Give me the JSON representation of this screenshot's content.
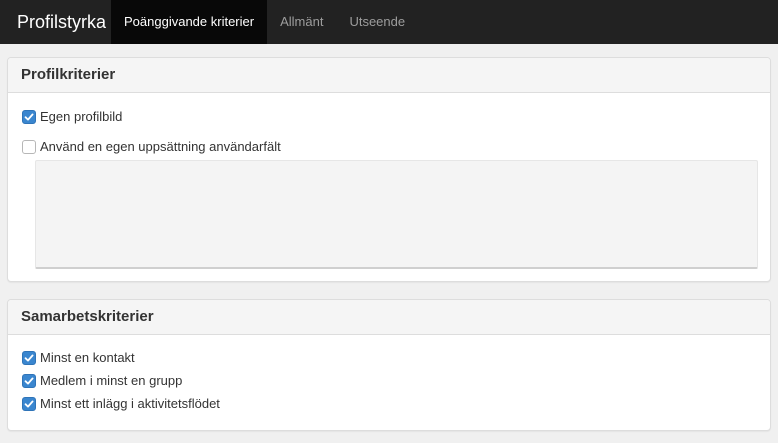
{
  "navbar": {
    "brand": "Profilstyrka",
    "tabs": [
      {
        "label": "Poänggivande kriterier",
        "active": true
      },
      {
        "label": "Allmänt",
        "active": false
      },
      {
        "label": "Utseende",
        "active": false
      }
    ]
  },
  "profile_panel": {
    "title": "Profilkriterier",
    "options": [
      {
        "label": "Egen profilbild",
        "checked": true
      },
      {
        "label": "Använd en egen uppsättning användarfält",
        "checked": false
      }
    ],
    "fields_textarea_value": ""
  },
  "collab_panel": {
    "title": "Samarbetskriterier",
    "options": [
      {
        "label": "Minst en kontakt",
        "checked": true
      },
      {
        "label": "Medlem i minst en grupp",
        "checked": true
      },
      {
        "label": "Minst ett inlägg i aktivitetsflödet",
        "checked": true
      }
    ]
  },
  "colors": {
    "navbar_bg": "#222222",
    "active_tab_bg": "#080808",
    "checkbox_checked": "#3a86cf"
  },
  "icons": {
    "check": "checkmark-icon"
  }
}
